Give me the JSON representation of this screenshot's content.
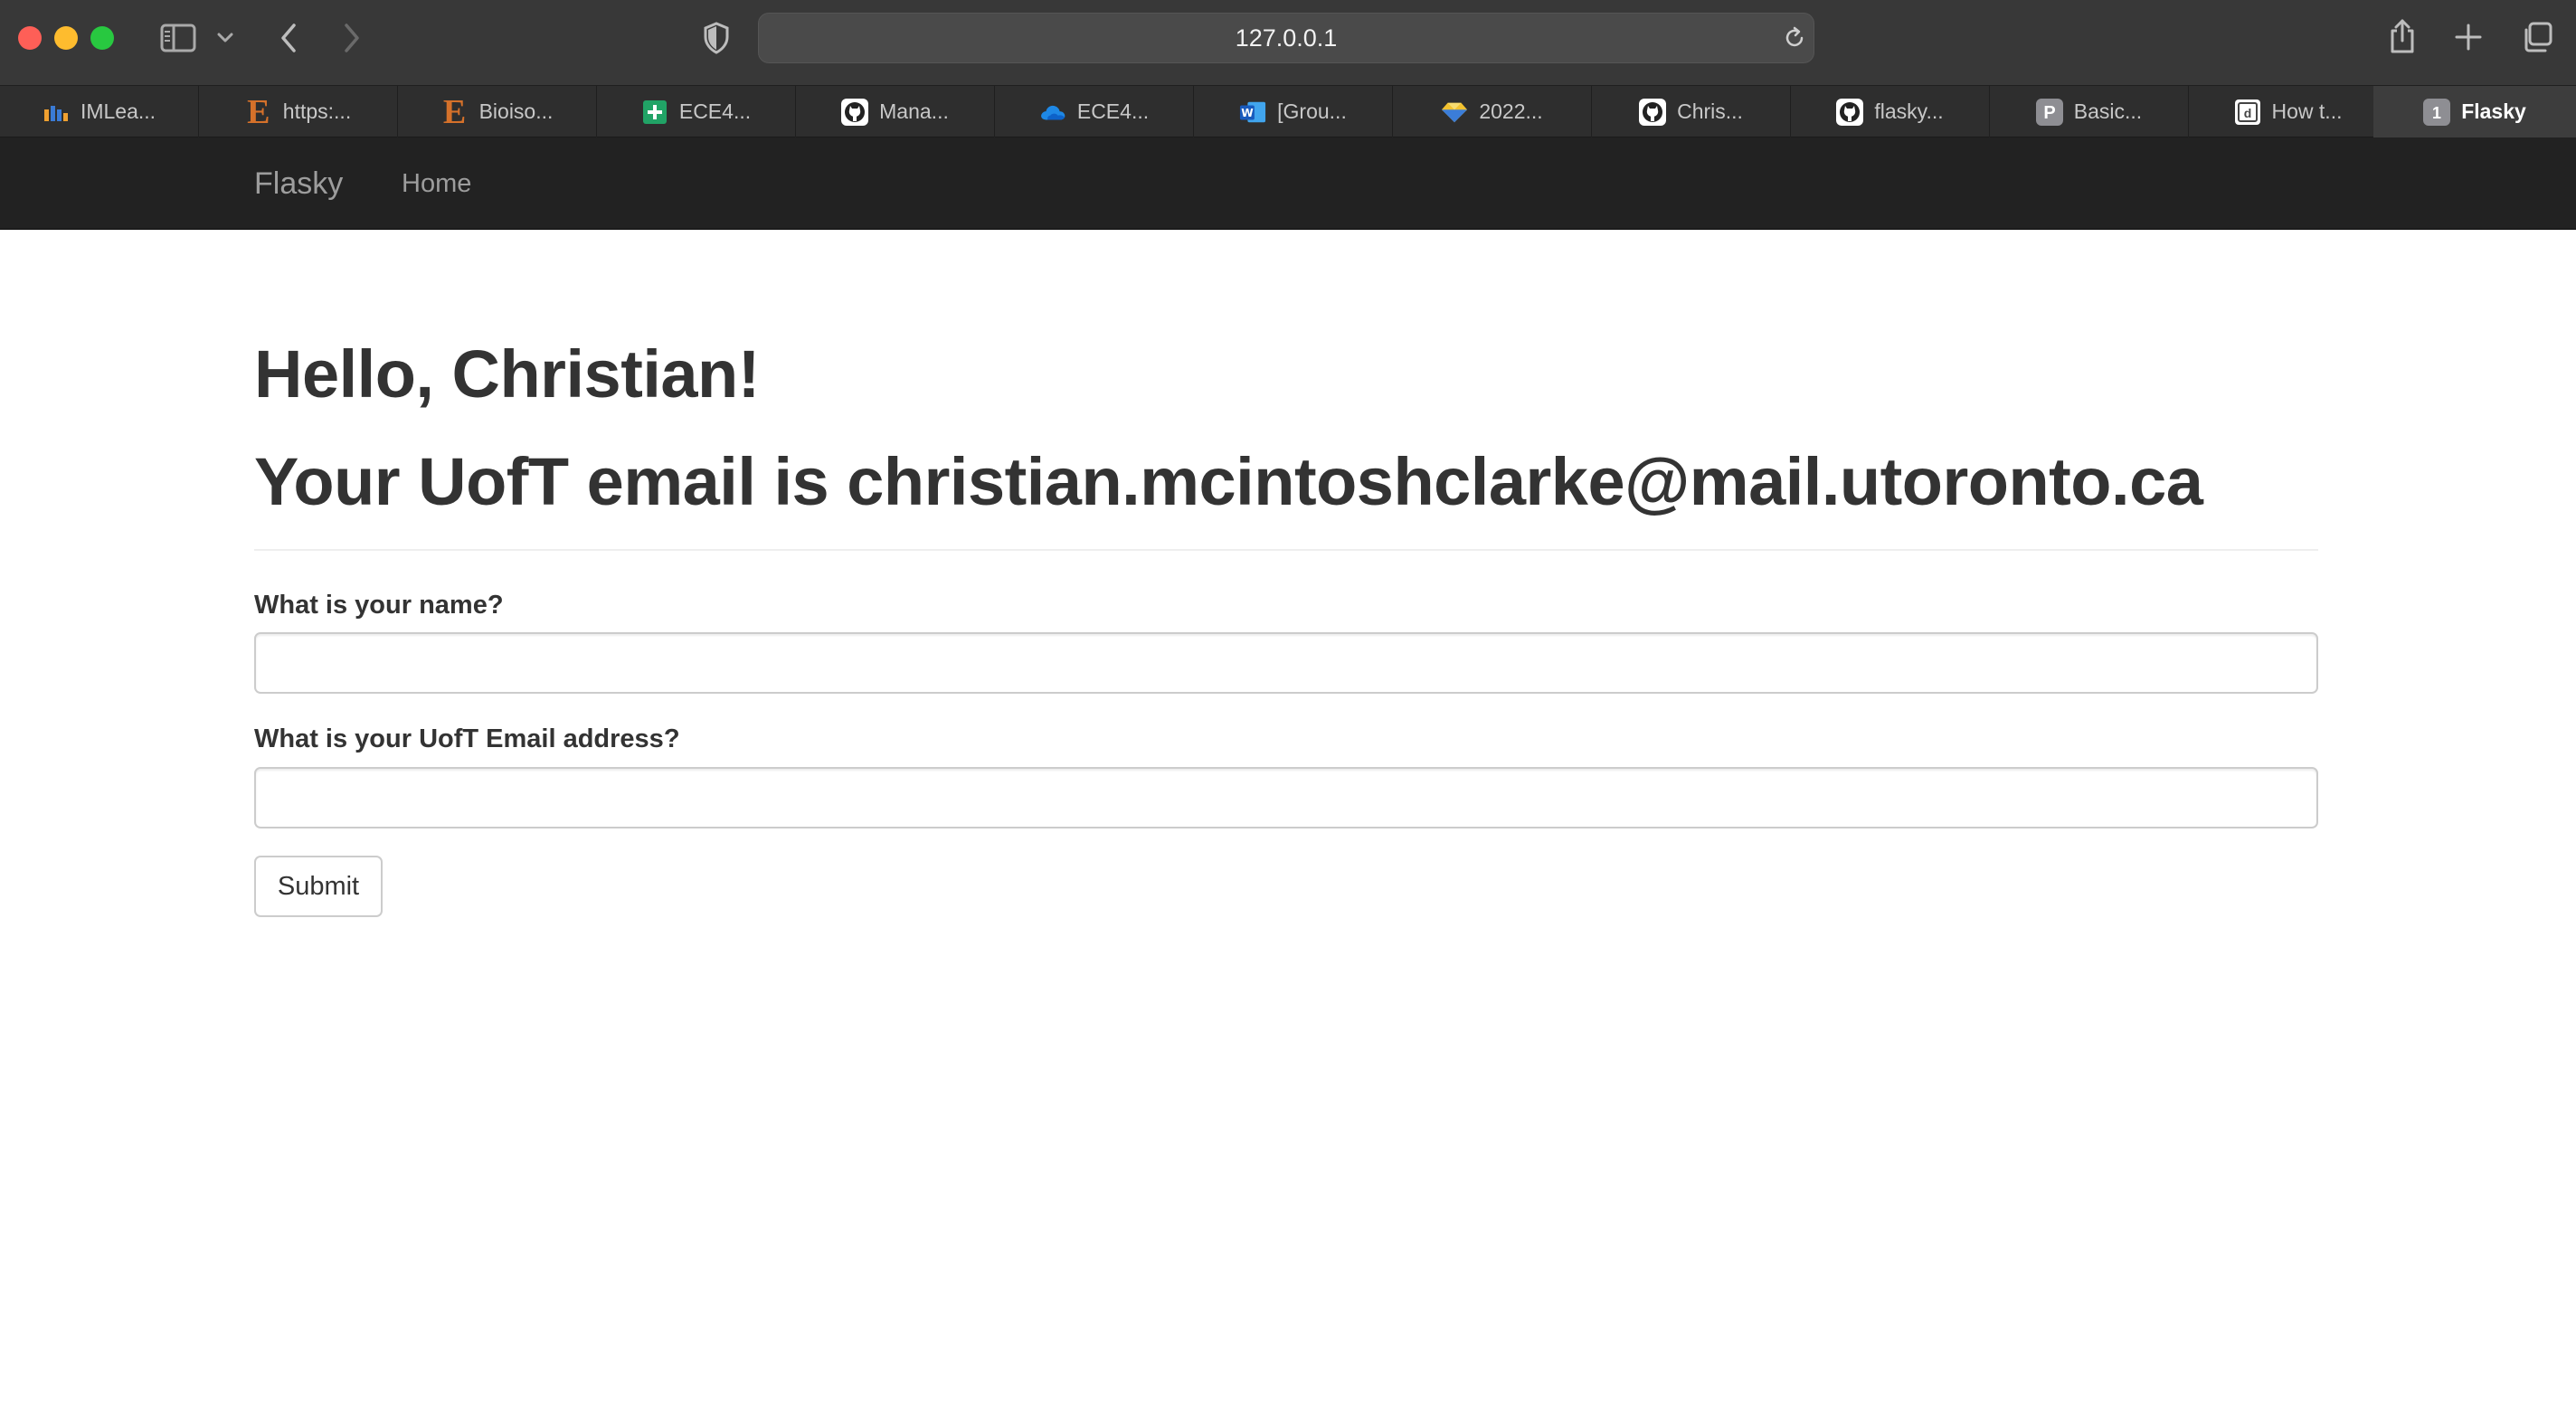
{
  "browser": {
    "url": "127.0.0.1",
    "tabs": [
      {
        "label": "IMLea...",
        "icon": "imlearn-favicon-icon"
      },
      {
        "label": "https:...",
        "icon": "e-letter-favicon-icon"
      },
      {
        "label": "Bioiso...",
        "icon": "e-letter-favicon-icon"
      },
      {
        "label": "ECE4...",
        "icon": "sheets-plus-favicon-icon"
      },
      {
        "label": "Mana...",
        "icon": "github-favicon-icon"
      },
      {
        "label": "ECE4...",
        "icon": "onedrive-cloud-favicon-icon"
      },
      {
        "label": "[Grou...",
        "icon": "word-favicon-icon"
      },
      {
        "label": "2022...",
        "icon": "diamond-favicon-icon"
      },
      {
        "label": "Chris...",
        "icon": "github-favicon-icon"
      },
      {
        "label": "flasky...",
        "icon": "github-favicon-icon"
      },
      {
        "label": "Basic...",
        "icon": "p-letter-favicon-icon"
      },
      {
        "label": "How t...",
        "icon": "doc-favicon-icon"
      },
      {
        "label": "Flasky",
        "icon": "number-one-favicon-icon",
        "badge": "1",
        "active": true
      }
    ],
    "colors": {
      "toolbar": "#383838",
      "tabstrip": "#2e2e2e",
      "active_tab": "#3d3d3d"
    }
  },
  "navbar": {
    "brand": "Flasky",
    "home": "Home",
    "background": "#222222"
  },
  "main": {
    "greeting": "Hello, Christian!",
    "email_line": "Your UofT email is christian.mcintoshclarke@mail.utoronto.ca",
    "form": {
      "name_label": "What is your name?",
      "name_value": "",
      "email_label": "What is your UofT Email address?",
      "email_value": "",
      "submit_label": "Submit"
    }
  }
}
